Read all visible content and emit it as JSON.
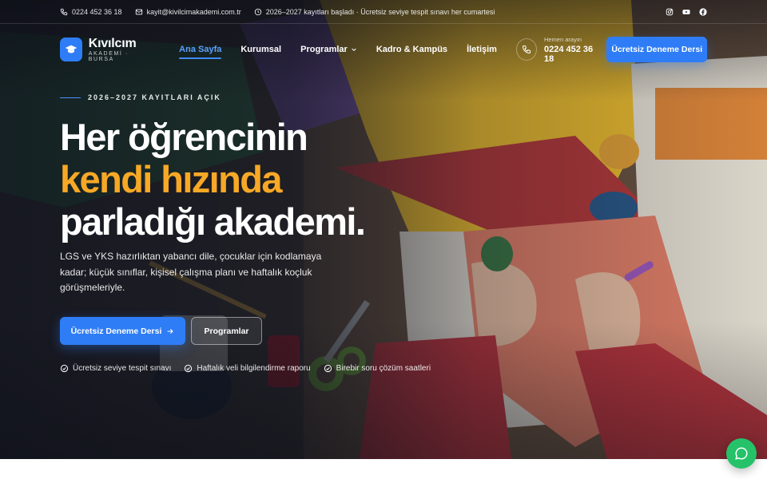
{
  "topbar": {
    "phone": "0224 452 36 18",
    "email": "kayit@kivilcimakademi.com.tr",
    "notice": "2026–2027 kayıtları başladı · Ücretsiz seviye tespit sınavı her cumartesi",
    "social": [
      "instagram-icon",
      "youtube-icon",
      "facebook-icon"
    ]
  },
  "brand": {
    "name": "Kıvılcım",
    "sub": "AKADEMİ · BURSA",
    "accent": "#2f7df6",
    "highlight": "#f7a826"
  },
  "nav": {
    "items": [
      {
        "label": "Ana Sayfa",
        "active": true
      },
      {
        "label": "Kurumsal",
        "active": false
      },
      {
        "label": "Programlar",
        "active": false
      },
      {
        "label": "Kadro & Kampüs",
        "active": false
      },
      {
        "label": "İletişim",
        "active": false
      }
    ]
  },
  "call": {
    "label": "Hemen arayın",
    "number": "0224 452 36 18"
  },
  "header_cta": "Ücretsiz Deneme Dersi",
  "hero": {
    "eyebrow": "2026–2027 KAYITLARI AÇIK",
    "headline_1": "Her öğrencinin",
    "headline_2": "kendi hızında",
    "headline_3": "parladığı akademi.",
    "lead": "LGS ve YKS hazırlıktan yabancı dile, çocuklar için kodlamaya kadar; küçük sınıflar, kişisel çalışma planı ve haftalık koçluk görüşmeleriyle.",
    "primary_cta": "Ücretsiz Deneme Dersi",
    "secondary_cta": "Programlar",
    "features": [
      "Ücretsiz seviye tespit sınavı",
      "Haftalık veli bilgilendirme raporu",
      "Birebir soru çözüm saatleri"
    ]
  },
  "chat": {
    "icon": "chat-bubble-icon",
    "color": "#25c26a"
  }
}
